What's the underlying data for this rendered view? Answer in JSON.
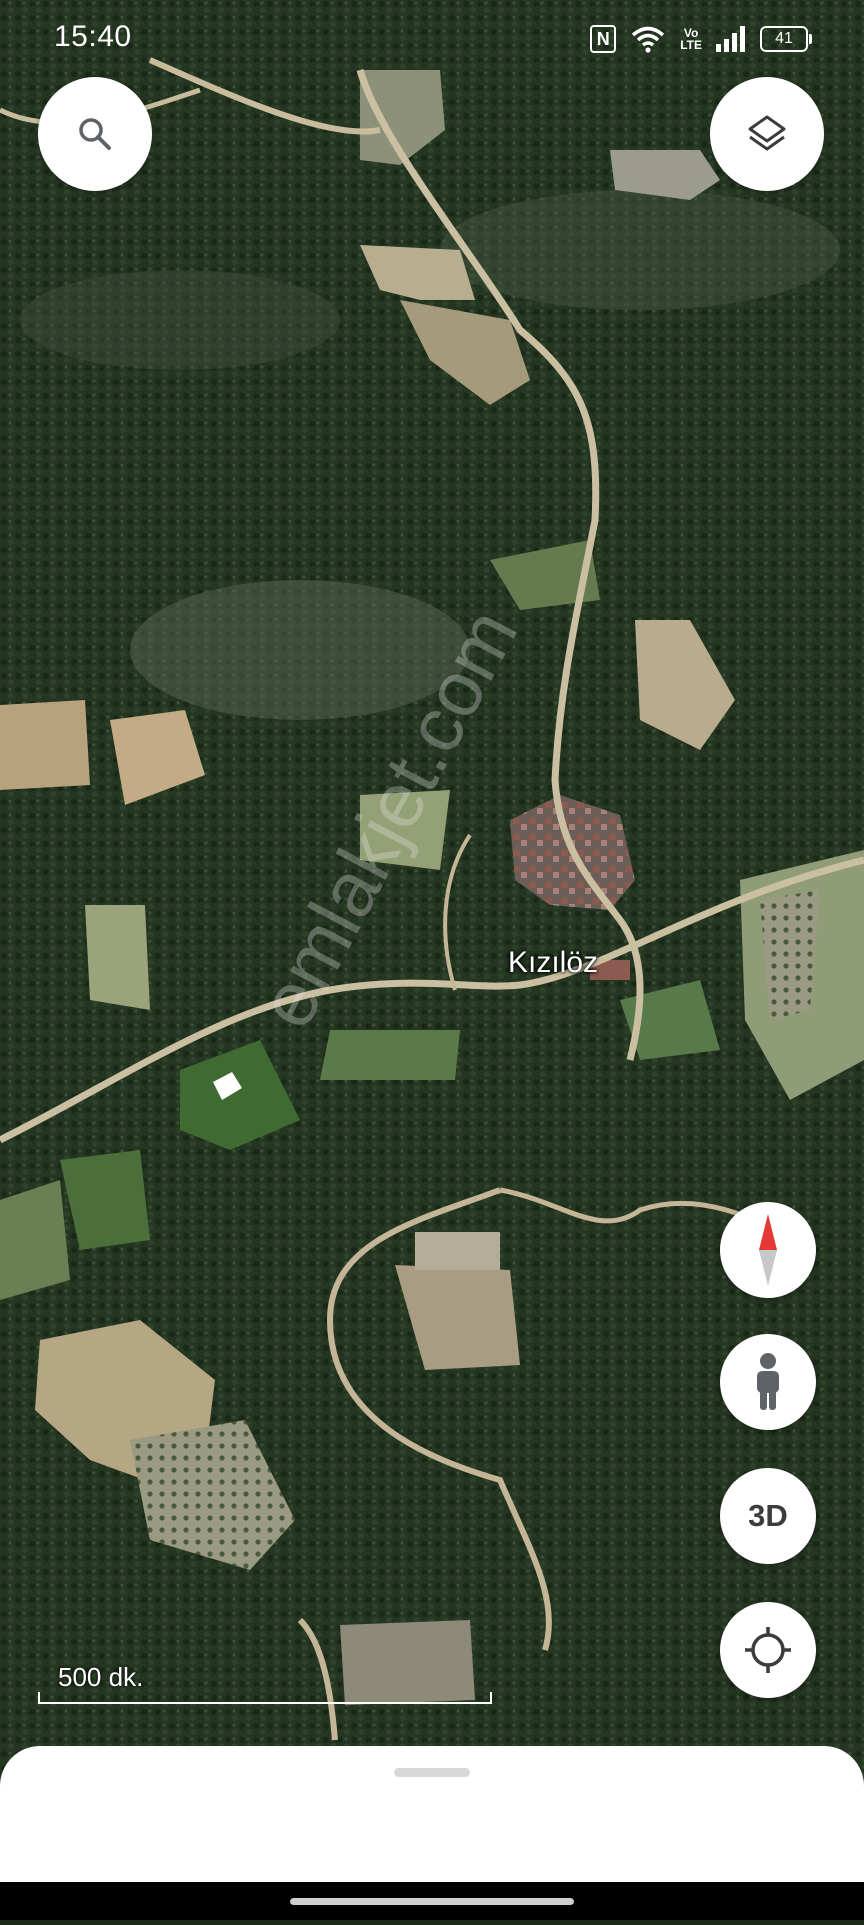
{
  "status_bar": {
    "time": "15:40",
    "nfc_label": "N",
    "volte_top": "Vo",
    "volte_bottom": "LTE",
    "battery": "41"
  },
  "icons": {
    "search": "search-icon",
    "layers": "layers-icon",
    "compass": "compass-icon",
    "street_view": "pegman-icon",
    "my_location": "my-location-icon"
  },
  "map": {
    "place_label": "Kızılöz",
    "watermark": "emlakjet.com",
    "scale_label": "500 dk."
  },
  "controls": {
    "three_d_label": "3D"
  },
  "colors": {
    "compass_north": "#e53935",
    "compass_south": "#c8c8c8",
    "button_bg": "#ffffff",
    "icon_gray": "#5f6368"
  }
}
